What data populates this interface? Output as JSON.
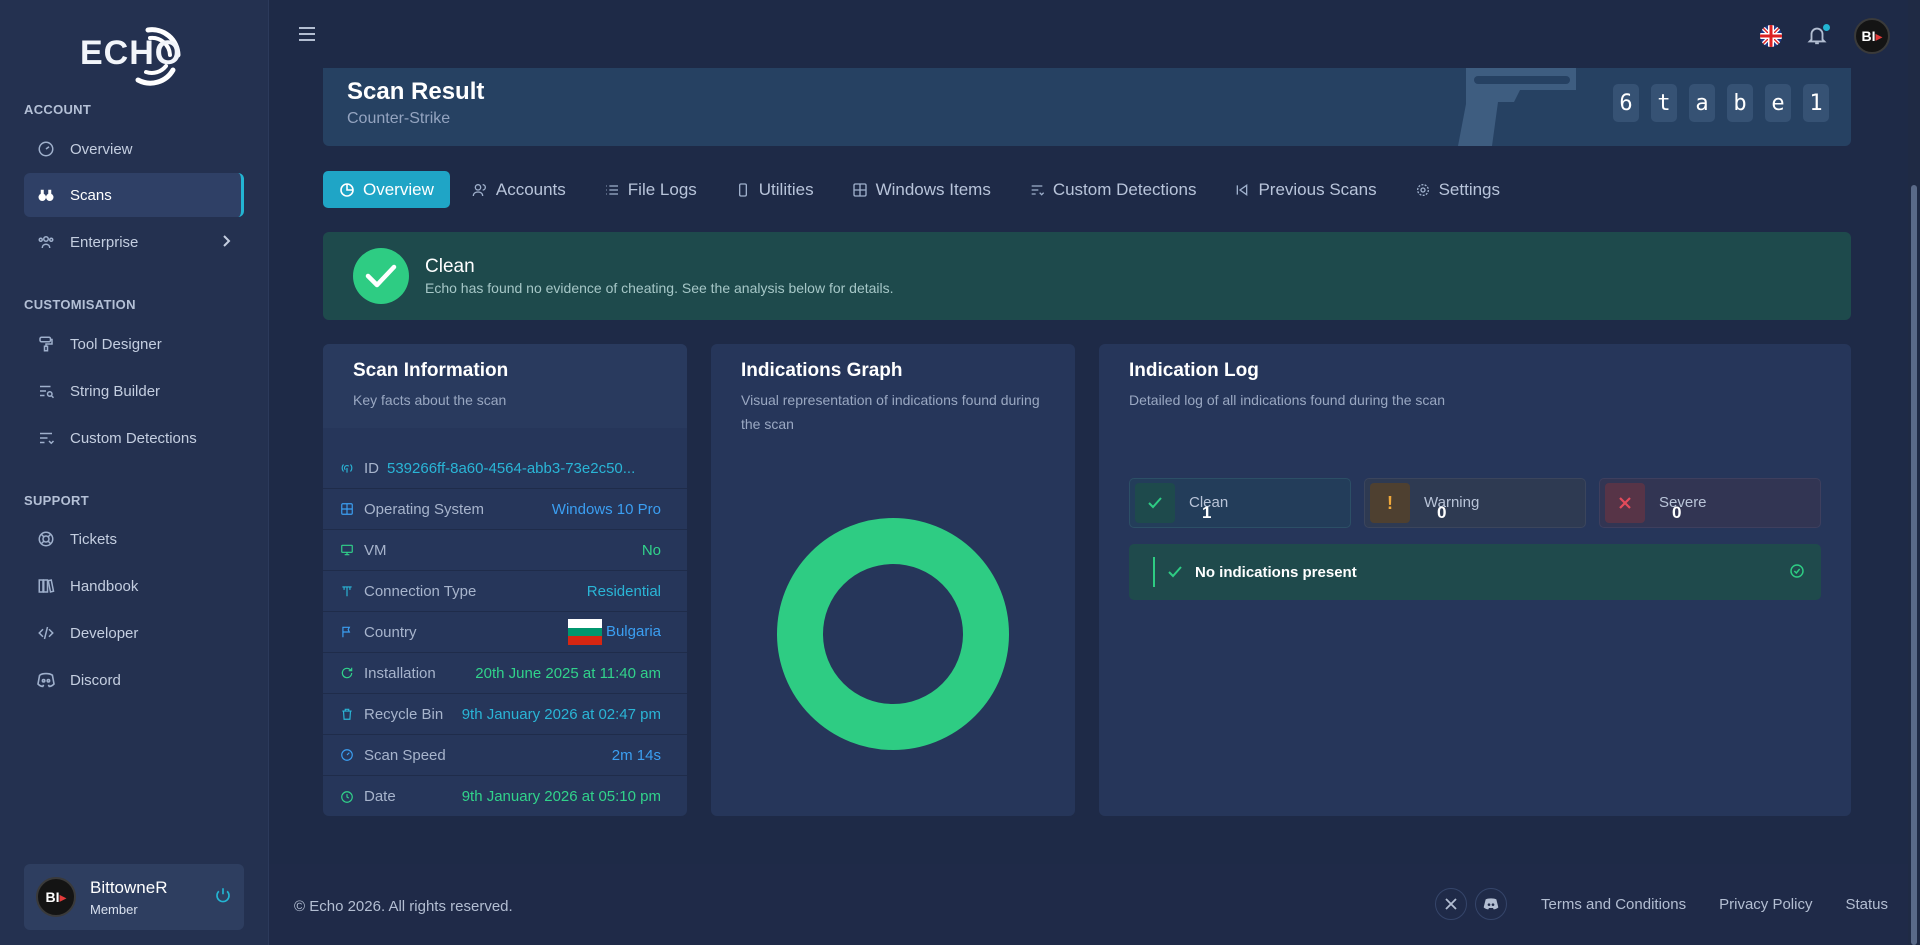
{
  "brand": {
    "logo_text": "ECHO"
  },
  "sidebar": {
    "sections": [
      {
        "title": "ACCOUNT"
      },
      {
        "title": "CUSTOMISATION"
      },
      {
        "title": "SUPPORT"
      }
    ],
    "items": [
      {
        "label": "Overview",
        "icon": "gauge-icon"
      },
      {
        "label": "Scans",
        "icon": "binoculars-icon",
        "active": true
      },
      {
        "label": "Enterprise",
        "icon": "users-icon"
      },
      {
        "label": "Tool Designer",
        "icon": "paint-roller-icon"
      },
      {
        "label": "String Builder",
        "icon": "list-search-icon"
      },
      {
        "label": "Custom Detections",
        "icon": "filter-list-icon"
      },
      {
        "label": "Tickets",
        "icon": "lifebuoy-icon"
      },
      {
        "label": "Handbook",
        "icon": "books-icon"
      },
      {
        "label": "Developer",
        "icon": "code-icon"
      },
      {
        "label": "Discord",
        "icon": "discord-icon"
      }
    ],
    "user": {
      "name": "BittowneR",
      "role": "Member",
      "avatar_text": "BI"
    }
  },
  "header": {
    "title": "Scan Result",
    "subtitle": "Counter-Strike",
    "code_chars": [
      "6",
      "t",
      "a",
      "b",
      "e",
      "1"
    ]
  },
  "tabs": [
    {
      "label": "Overview",
      "active": true
    },
    {
      "label": "Accounts"
    },
    {
      "label": "File Logs"
    },
    {
      "label": "Utilities"
    },
    {
      "label": "Windows Items"
    },
    {
      "label": "Custom Detections"
    },
    {
      "label": "Previous Scans"
    },
    {
      "label": "Settings"
    }
  ],
  "status": {
    "title": "Clean",
    "description": "Echo has found no evidence of cheating. See the analysis below for details."
  },
  "scan_info": {
    "title": "Scan Information",
    "subtitle": "Key facts about the scan",
    "rows": [
      {
        "label": "ID",
        "value": "539266ff-8a60-4564-abb3-73e2c50..."
      },
      {
        "label": "Operating System",
        "value": "Windows 10 Pro"
      },
      {
        "label": "VM",
        "value": "No"
      },
      {
        "label": "Connection Type",
        "value": "Residential"
      },
      {
        "label": "Country",
        "value": "Bulgaria"
      },
      {
        "label": "Installation",
        "value": "20th June 2025 at 11:40 am"
      },
      {
        "label": "Recycle Bin",
        "value": "9th January 2026 at 02:47 pm"
      },
      {
        "label": "Scan Speed",
        "value": "2m 14s"
      },
      {
        "label": "Date",
        "value": "9th January 2026 at 05:10 pm"
      }
    ]
  },
  "graph": {
    "title": "Indications Graph",
    "subtitle": "Visual representation of indications found during the scan"
  },
  "chart_data": {
    "type": "pie",
    "categories": [
      "Clean",
      "Warning",
      "Severe"
    ],
    "values": [
      1,
      0,
      0
    ],
    "colors": [
      "#2ecc83",
      "#f0a83a",
      "#e34b5a"
    ],
    "donut": true
  },
  "log": {
    "title": "Indication Log",
    "subtitle": "Detailed log of all indications found during the scan",
    "counters": [
      {
        "label": "Clean",
        "value": "1",
        "color": "#2ecc83"
      },
      {
        "label": "Warning",
        "value": "0",
        "color": "#f0a83a"
      },
      {
        "label": "Severe",
        "value": "0",
        "color": "#e34b5a"
      }
    ],
    "empty_message": "No indications present"
  },
  "footer": {
    "copyright": "© Echo 2026. All rights reserved.",
    "links": [
      "Terms and Conditions",
      "Privacy Policy",
      "Status"
    ]
  }
}
